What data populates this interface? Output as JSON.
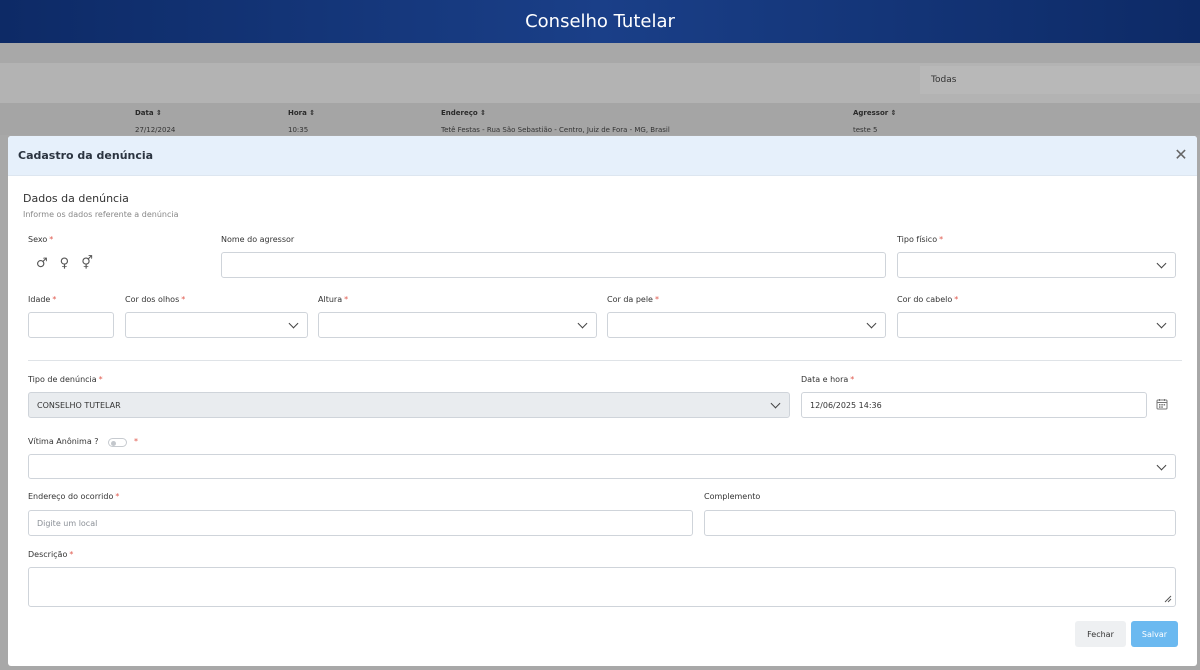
{
  "app": {
    "title": "Conselho Tutelar"
  },
  "background": {
    "filter_value": "Todas",
    "table": {
      "headers": [
        "Data ⇕",
        "Hora ⇕",
        "Endereço ⇕",
        "Agressor ⇕"
      ],
      "row": [
        "27/12/2024",
        "10:35",
        "Tetê Festas - Rua São Sebastião - Centro, Juiz de Fora - MG, Brasil",
        "teste 5"
      ]
    }
  },
  "modal": {
    "title": "Cadastro da denúncia",
    "section_title": "Dados da denúncia",
    "section_subtitle": "Informe os dados referente a denúncia",
    "labels": {
      "sexo": "Sexo",
      "nome_agressor": "Nome do agressor",
      "tipo_fisico": "Tipo físico",
      "idade": "Idade",
      "cor_olhos": "Cor dos olhos",
      "altura": "Altura",
      "cor_pele": "Cor da pele",
      "cor_cabelo": "Cor do cabelo",
      "tipo_denuncia": "Tipo de denúncia",
      "data_hora": "Data e hora",
      "vitima_anonima": "Vítima Anônima ?",
      "endereco": "Endereço do ocorrido",
      "complemento": "Complemento",
      "descricao": "Descrição"
    },
    "required_mark": "*",
    "sex_icons": [
      "♂",
      "♀",
      "⚥"
    ],
    "values": {
      "tipo_denuncia": "CONSELHO TUTELAR",
      "data_hora": "12/06/2025 14:36"
    },
    "placeholders": {
      "endereco": "Digite um local"
    },
    "buttons": {
      "close": "Fechar",
      "save": "Salvar"
    },
    "close_glyph": "✕"
  }
}
